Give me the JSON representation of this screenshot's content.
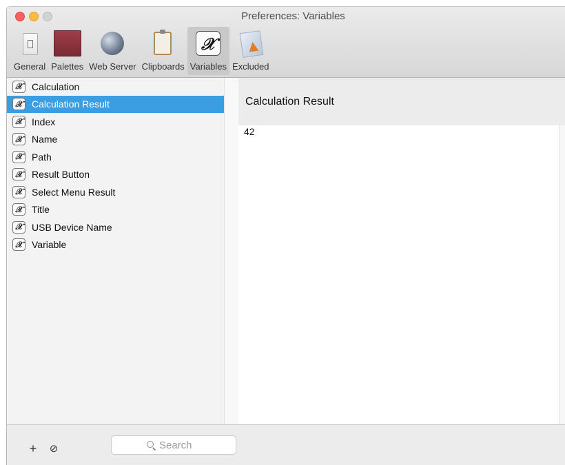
{
  "window": {
    "title": "Preferences: Variables"
  },
  "toolbar": {
    "items": [
      {
        "label": "General",
        "icon": "general-switch-icon"
      },
      {
        "label": "Palettes",
        "icon": "palettes-icon"
      },
      {
        "label": "Web Server",
        "icon": "globe-icon"
      },
      {
        "label": "Clipboards",
        "icon": "clipboard-icon"
      },
      {
        "label": "Variables",
        "icon": "variable-x-icon",
        "selected": true
      },
      {
        "label": "Excluded",
        "icon": "excluded-app-icon"
      }
    ]
  },
  "sidebar": {
    "items": [
      {
        "label": "Calculation"
      },
      {
        "label": "Calculation Result",
        "selected": true
      },
      {
        "label": "Index"
      },
      {
        "label": "Name"
      },
      {
        "label": "Path"
      },
      {
        "label": "Result Button"
      },
      {
        "label": "Select Menu Result"
      },
      {
        "label": "Title"
      },
      {
        "label": "USB Device Name"
      },
      {
        "label": "Variable"
      }
    ],
    "item_icon_glyph": "𝒳"
  },
  "detail": {
    "title": "Calculation Result",
    "value": "42"
  },
  "bottom": {
    "add_label": "+",
    "remove_label": "⊘",
    "search_placeholder": "Search"
  },
  "colors": {
    "selection": "#3b9ee2",
    "close": "#fc605c",
    "minimize": "#fdbc40",
    "zoom": "#d2d2d2"
  }
}
